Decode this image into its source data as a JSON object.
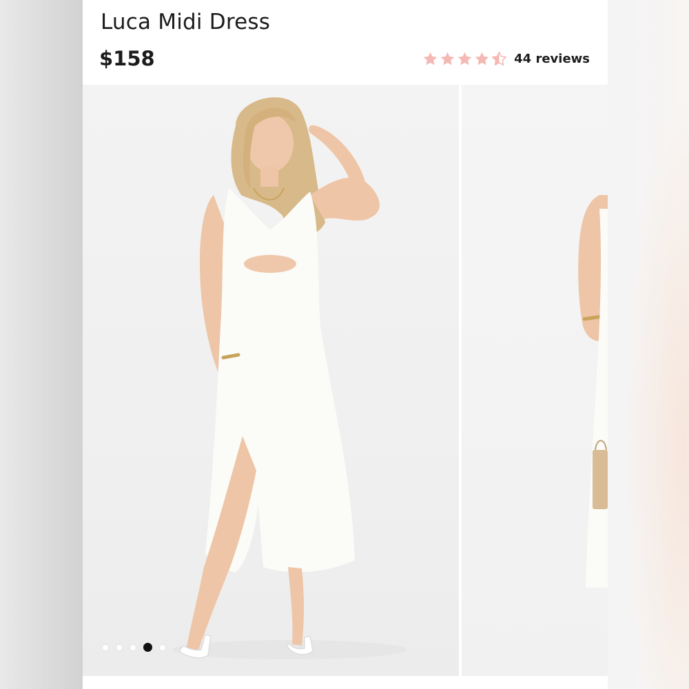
{
  "product": {
    "title": "Luca Midi Dress",
    "price": "$158",
    "rating": {
      "value": 4.5,
      "max": 5,
      "reviews_label": "44 reviews",
      "star_color": "#f4b9b4"
    }
  },
  "gallery": {
    "total_images": 5,
    "active_index": 3,
    "images": [
      {
        "icon": "model-front-photo"
      },
      {
        "icon": "model-side-photo"
      }
    ]
  }
}
